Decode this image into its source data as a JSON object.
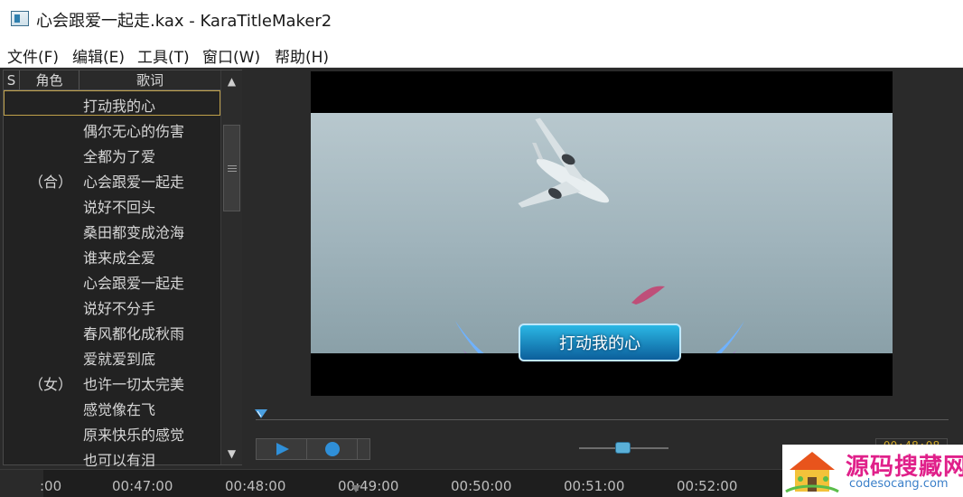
{
  "window": {
    "title": "心会跟爱一起走.kax - KaraTitleMaker2"
  },
  "menu": [
    "文件(F)",
    "编辑(E)",
    "工具(T)",
    "窗口(W)",
    "帮助(H)"
  ],
  "lyrics": {
    "columns": {
      "s": "S",
      "role": "角色",
      "lyric": "歌词"
    },
    "rows": [
      {
        "role": "",
        "text": "打动我的心",
        "selected": true
      },
      {
        "role": "",
        "text": "偶尔无心的伤害"
      },
      {
        "role": "",
        "text": "全都为了爱"
      },
      {
        "role": "（合）",
        "text": "心会跟爱一起走"
      },
      {
        "role": "",
        "text": "说好不回头"
      },
      {
        "role": "",
        "text": "桑田都变成沧海"
      },
      {
        "role": "",
        "text": "谁来成全爱"
      },
      {
        "role": "",
        "text": "心会跟爱一起走"
      },
      {
        "role": "",
        "text": "说好不分手"
      },
      {
        "role": "",
        "text": "春风都化成秋雨"
      },
      {
        "role": "",
        "text": "爱就爱到底"
      },
      {
        "role": "（女）",
        "text": "也许一切太完美"
      },
      {
        "role": "",
        "text": "感觉像在飞"
      },
      {
        "role": "",
        "text": "原来快乐的感觉"
      },
      {
        "role": "",
        "text": "也可以有泪"
      }
    ]
  },
  "preview": {
    "caption": "打动我的心"
  },
  "transport": {
    "time": "00:48:08"
  },
  "ruler": {
    "ticks": [
      ":00",
      "00:47:00",
      "00:48:00",
      "00:49:00",
      "00:50:00",
      "00:51:00",
      "00:52:00"
    ]
  },
  "watermark": {
    "title": "源码搜藏网",
    "url": "codesocang.com"
  },
  "colors": {
    "accent": "#2f8fd8",
    "time": "#c9a227",
    "selection": "#bfa14a"
  }
}
